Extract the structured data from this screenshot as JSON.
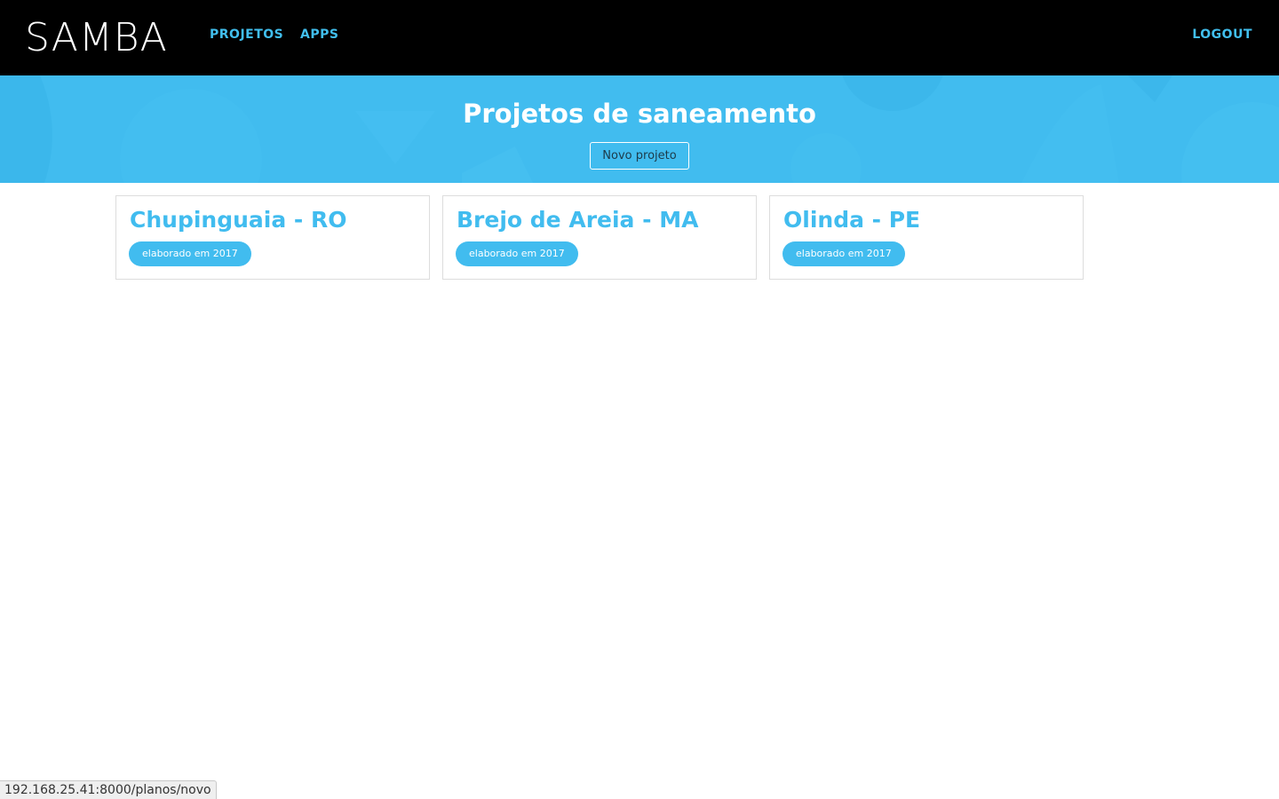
{
  "navbar": {
    "logo_text": "SAMBA",
    "links": [
      "PROJETOS",
      "APPS"
    ],
    "logout_label": "LOGOUT"
  },
  "hero": {
    "title": "Projetos de saneamento",
    "new_button_label": "Novo projeto"
  },
  "projects": [
    {
      "name": "Chupinguaia - RO",
      "badge": "elaborado em 2017"
    },
    {
      "name": "Brejo de Areia - MA",
      "badge": "elaborado em 2017"
    },
    {
      "name": "Olinda - PE",
      "badge": "elaborado em 2017"
    }
  ],
  "status_url": "192.168.25.41:8000/planos/novo",
  "colors": {
    "navbar_bg": "#000000",
    "accent": "#41bcef",
    "card_border": "#dddddd"
  }
}
